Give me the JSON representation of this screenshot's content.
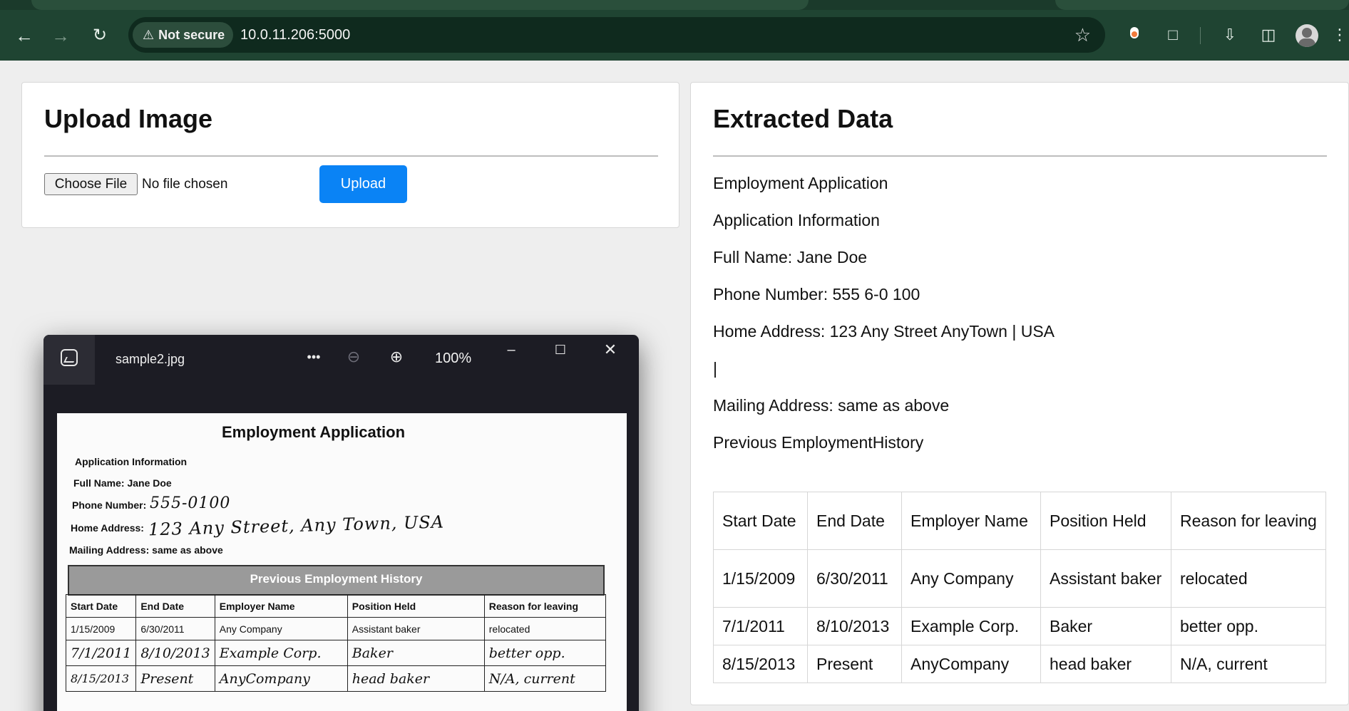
{
  "browser": {
    "security_label": "Not secure",
    "url": "10.0.11.206:5000",
    "icons": [
      "back-icon",
      "forward-icon",
      "reload-icon",
      "warning-icon",
      "star-icon",
      "extension-icon",
      "download-icon",
      "sidepanel-icon",
      "profile-icon",
      "menu-icon"
    ]
  },
  "upload": {
    "title": "Upload Image",
    "choose_file_label": "Choose File",
    "no_file_label": "No file chosen",
    "upload_label": "Upload"
  },
  "extracted": {
    "title": "Extracted Data",
    "lines": [
      "Employment Application",
      "Application Information",
      "Full Name: Jane Doe",
      "Phone Number: 555 6-0 100",
      "Home Address: 123 Any Street AnyTown | USA",
      "|",
      "Mailing Address: same as above",
      "Previous EmploymentHistory"
    ],
    "table": {
      "headers": [
        "Start Date",
        "End Date",
        "Employer Name",
        "Position Held",
        "Reason for leaving"
      ],
      "rows": [
        [
          "1/15/2009",
          "6/30/2011",
          "Any Company",
          "Assistant baker",
          "relocated"
        ],
        [
          "7/1/2011",
          "8/10/2013",
          "Example Corp.",
          "Baker",
          "better opp."
        ],
        [
          "8/15/2013",
          "Present",
          "AnyCompany",
          "head baker",
          "N/A, current"
        ]
      ]
    }
  },
  "viewer": {
    "filename": "sample2.jpg",
    "more_label": "•••",
    "zoom": "100%",
    "document": {
      "title": "Employment Application",
      "app_info": "Application Information",
      "full_name": "Full Name: Jane Doe",
      "phone_label": "Phone Number:",
      "phone_value": "555-0100",
      "home_label": "Home Address:",
      "home_value": "123 Any Street, Any Town, USA",
      "mailing": "Mailing Address: same as above",
      "band": "Previous Employment History",
      "headers": [
        "Start Date",
        "End Date",
        "Employer Name",
        "Position Held",
        "Reason for leaving"
      ],
      "typed_row": [
        "1/15/2009",
        "6/30/2011",
        "Any Company",
        "Assistant baker",
        "relocated"
      ],
      "hand_rows": [
        [
          "7/1/2011",
          "8/10/2013",
          "Example Corp.",
          "Baker",
          "better opp."
        ],
        [
          "8/15/2013",
          "Present",
          "AnyCompany",
          "head baker",
          "N/A, current"
        ]
      ]
    }
  }
}
